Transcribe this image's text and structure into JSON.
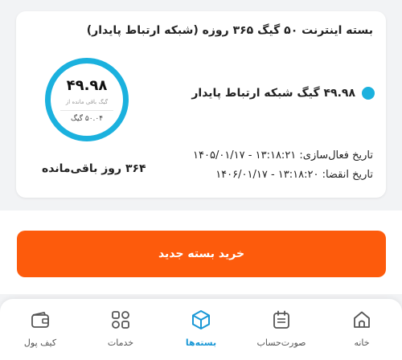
{
  "package": {
    "title": "بسته اینترنت ۵۰ گیگ ۳۶۵ روزه (شبکه ارتباط پایدار)",
    "remaining_main": "۴۹.۹۸",
    "remaining_caption": "گیگ باقی مانده از",
    "total": "۵۰.۰۴ گیگ",
    "network_line": "۴۹.۹۸ گیگ شبکه ارتباط پایدار",
    "activation": "تاریخ فعال‌سازی: ۱۳:۱۸:۲۱ - ۱۴۰۵/۰۱/۱۷",
    "expiry": "تاریخ انقضا: ۱۳:۱۸:۲۰ - ۱۴۰۶/۰۱/۱۷",
    "days_left": "۳۶۴ روز باقی‌مانده",
    "accent_color": "#1bb1de"
  },
  "buy_button": {
    "label": "خرید بسته جدید",
    "color": "#fd5b0c"
  },
  "nav": {
    "active_color": "#1a98d6",
    "items": [
      {
        "label": "کیف پول",
        "icon": "wallet-icon"
      },
      {
        "label": "خدمات",
        "icon": "services-grid-icon"
      },
      {
        "label": "بسته‌ها",
        "icon": "package-box-icon",
        "active": true
      },
      {
        "label": "صورت‌حساب",
        "icon": "bill-icon"
      },
      {
        "label": "خانه",
        "icon": "home-icon"
      }
    ]
  }
}
